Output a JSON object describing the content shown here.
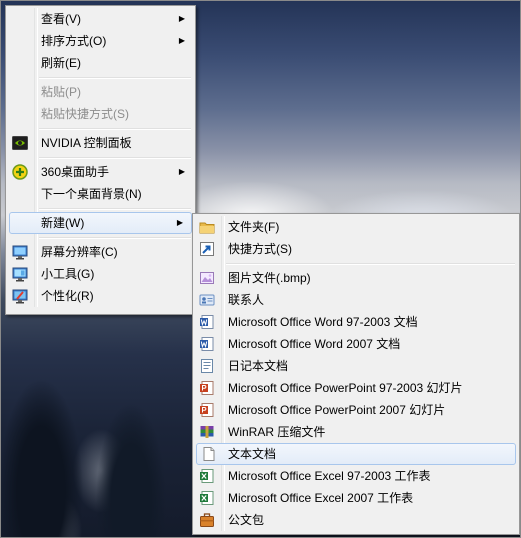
{
  "main_menu": {
    "items": [
      {
        "label": "查看(V)"
      },
      {
        "label": "排序方式(O)"
      },
      {
        "label": "刷新(E)"
      },
      {
        "label": "粘贴(P)"
      },
      {
        "label": "粘贴快捷方式(S)"
      },
      {
        "label": "NVIDIA 控制面板",
        "icon": "nvidia-icon"
      },
      {
        "label": "360桌面助手",
        "icon": "360-icon"
      },
      {
        "label": "下一个桌面背景(N)"
      },
      {
        "label": "新建(W)"
      },
      {
        "label": "屏幕分辨率(C)",
        "icon": "display-icon"
      },
      {
        "label": "小工具(G)",
        "icon": "gadget-icon"
      },
      {
        "label": "个性化(R)",
        "icon": "personalize-icon"
      }
    ],
    "submenu_arrow": "▶"
  },
  "new_submenu": {
    "items": [
      {
        "label": "文件夹(F)",
        "icon": "folder-icon"
      },
      {
        "label": "快捷方式(S)",
        "icon": "shortcut-icon"
      },
      {
        "label": "图片文件(.bmp)",
        "icon": "bitmap-icon"
      },
      {
        "label": "联系人",
        "icon": "contact-icon"
      },
      {
        "label": "Microsoft Office Word 97-2003 文档",
        "icon": "word-icon"
      },
      {
        "label": "Microsoft Office Word 2007 文档",
        "icon": "word-icon"
      },
      {
        "label": "日记本文档",
        "icon": "journal-icon"
      },
      {
        "label": "Microsoft Office PowerPoint 97-2003 幻灯片",
        "icon": "powerpoint-icon"
      },
      {
        "label": "Microsoft Office PowerPoint 2007 幻灯片",
        "icon": "powerpoint-icon"
      },
      {
        "label": "WinRAR 压缩文件",
        "icon": "winrar-icon"
      },
      {
        "label": "文本文档",
        "icon": "text-document-icon"
      },
      {
        "label": "Microsoft Office Excel 97-2003 工作表",
        "icon": "excel-icon"
      },
      {
        "label": "Microsoft Office Excel 2007 工作表",
        "icon": "excel-icon"
      },
      {
        "label": "公文包",
        "icon": "briefcase-icon"
      }
    ]
  },
  "colors": {
    "menu_bg": "#f0f0f0",
    "highlight_border": "#a8c6ec",
    "disabled_text": "#8d8d8d"
  }
}
